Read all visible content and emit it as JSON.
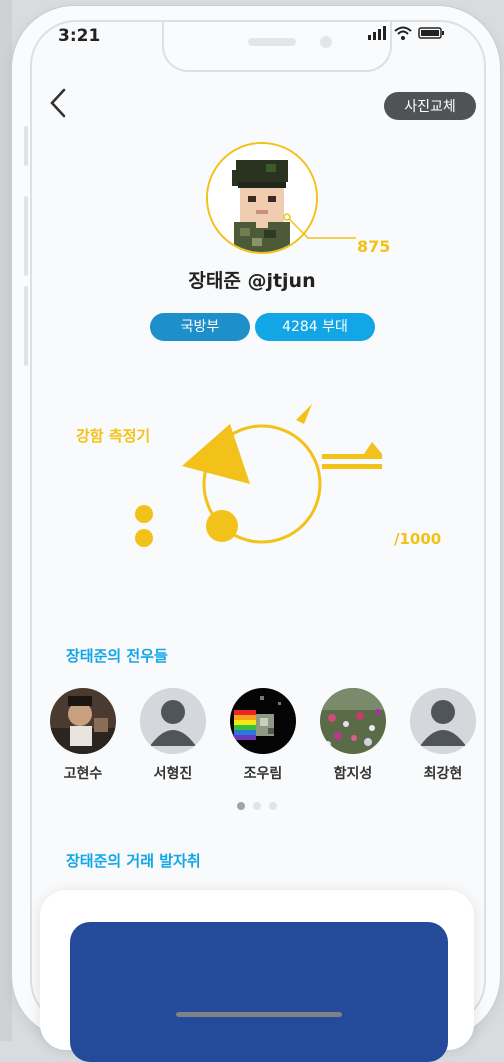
{
  "status_bar": {
    "time": "3:21"
  },
  "header": {
    "change_photo_label": "사진교체"
  },
  "profile": {
    "score": "875",
    "name": "장태준 @jtjun",
    "tags": [
      "국방부",
      "4284 부대"
    ]
  },
  "meter": {
    "label": "강함 측정기",
    "max_text": "/1000"
  },
  "comrades": {
    "title": "장태준의 전우들",
    "items": [
      {
        "name": "고현수"
      },
      {
        "name": "서형진"
      },
      {
        "name": "조우림"
      },
      {
        "name": "함지성"
      },
      {
        "name": "최강현"
      }
    ],
    "page_count": 3,
    "active_page": 1
  },
  "trade": {
    "title": "장태준의 거래 발자취"
  },
  "colors": {
    "accent_yellow": "#f2c21a",
    "accent_blue": "#12a6e6",
    "tag_blue": "#1d8fc9",
    "card_blue": "#244a9a"
  }
}
